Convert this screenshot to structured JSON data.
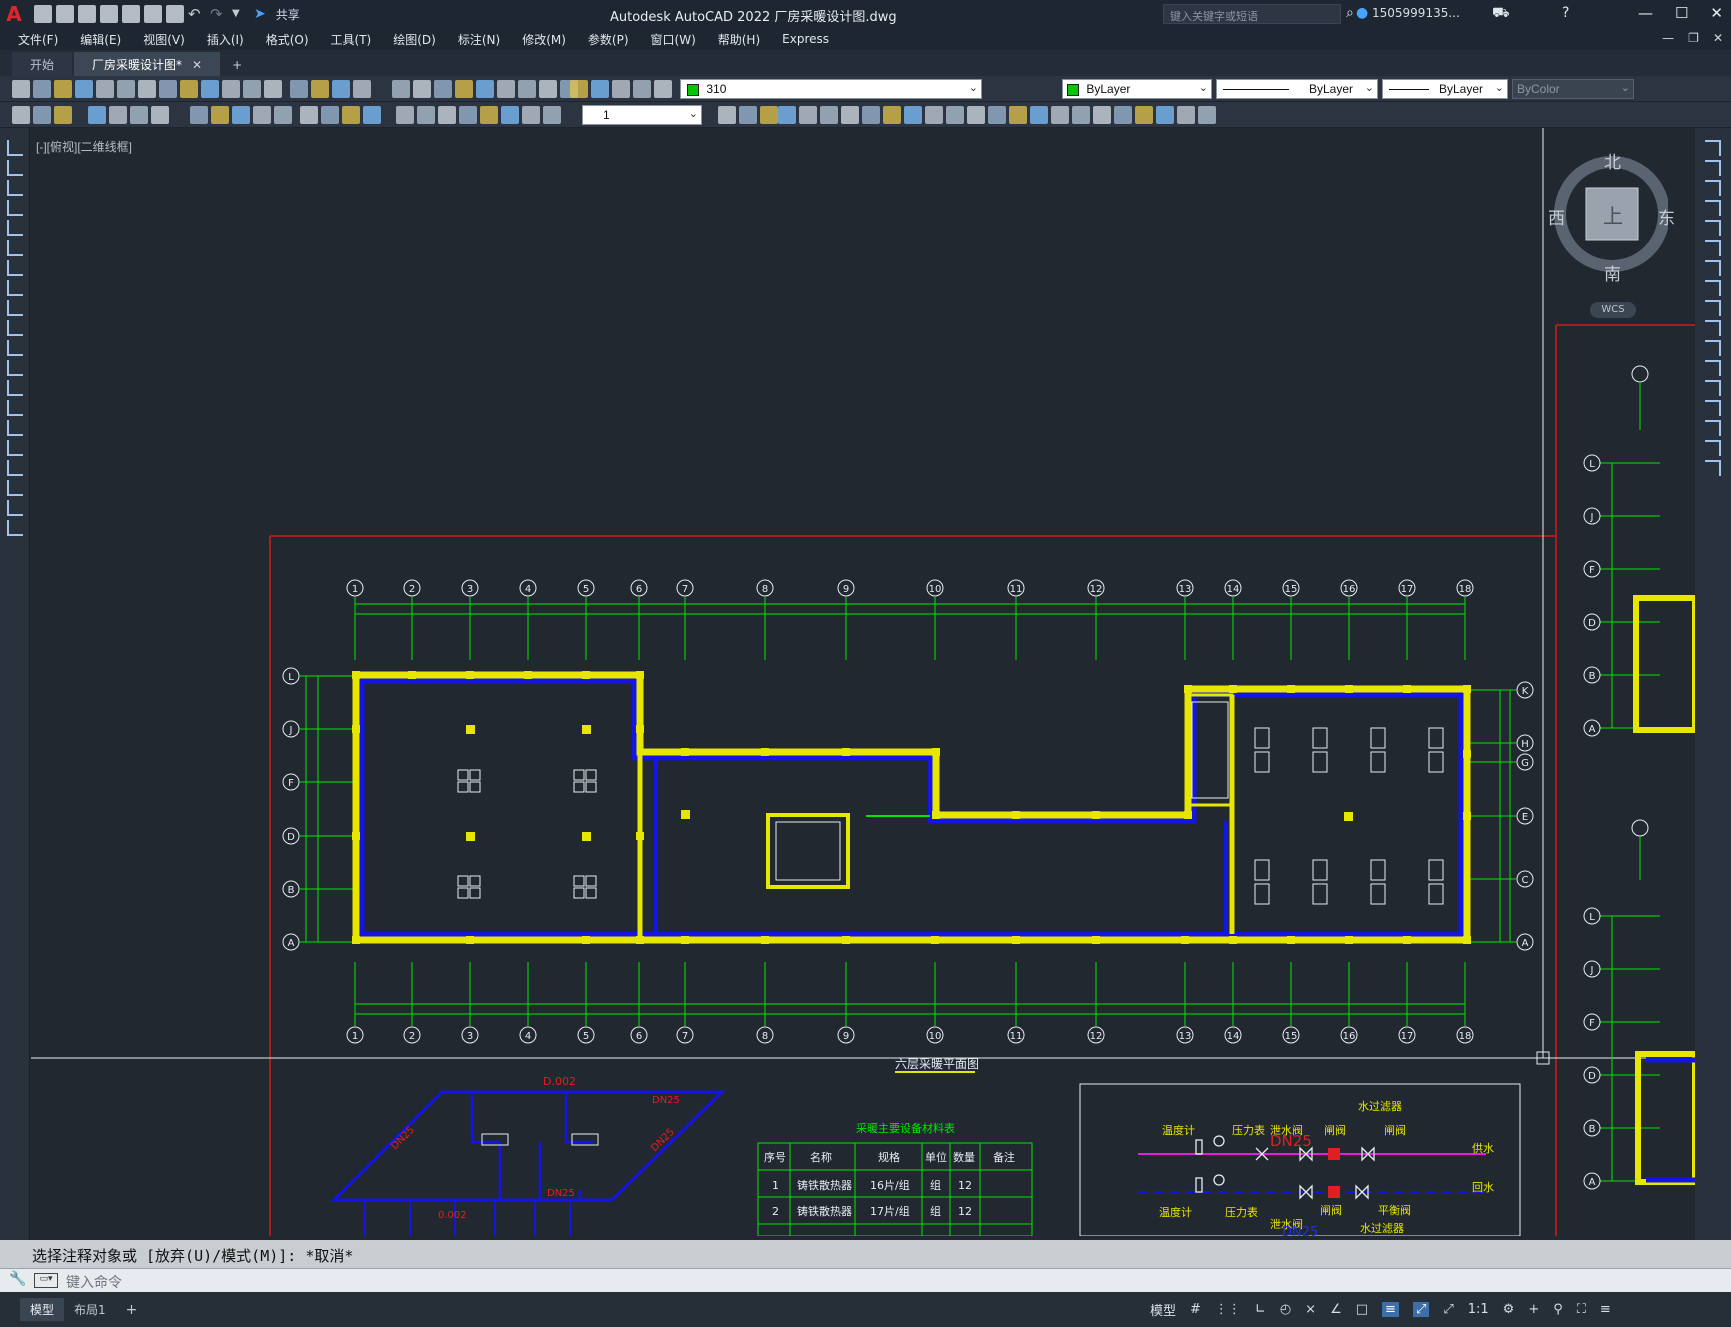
{
  "app": {
    "logo": "A",
    "title": "Autodesk AutoCAD 2022    厂房采暖设计图.dwg",
    "share": "共享",
    "search_placeholder": "键入关键字或短语",
    "user": "1505999135...",
    "window_controls": [
      "—",
      "☐",
      "✕"
    ]
  },
  "menu": [
    "文件(F)",
    "编辑(E)",
    "视图(V)",
    "插入(I)",
    "格式(O)",
    "工具(T)",
    "绘图(D)",
    "标注(N)",
    "修改(M)",
    "参数(P)",
    "窗口(W)",
    "帮助(H)",
    "Express"
  ],
  "tabs": {
    "start": "开始",
    "active": "厂房采暖设计图*",
    "close": "✕",
    "add": "+"
  },
  "toolbar": {
    "layer_value": "310",
    "color_value": "ByLayer",
    "linetype_value": "ByLayer",
    "lineweight_value": "ByLayer",
    "plotstyle_value": "ByColor",
    "scale_value": "1",
    "layer_color": "#00c800"
  },
  "viewport": {
    "label": "[-][俯视][二维线框]"
  },
  "viewcube": {
    "north": "北",
    "south": "南",
    "east": "东",
    "west": "西",
    "top": "上",
    "wcs": "WCS"
  },
  "drawing": {
    "axis_top": [
      "1",
      "2",
      "3",
      "4",
      "5",
      "6",
      "7",
      "8",
      "9",
      "10",
      "11",
      "12",
      "13",
      "14",
      "15",
      "16",
      "17",
      "18"
    ],
    "axis_left": [
      "L",
      "J",
      "F",
      "D",
      "B",
      "A"
    ],
    "axis_right": [
      "K",
      "H",
      "G",
      "E",
      "C",
      "A"
    ],
    "plan_title": "六层采暖平面图",
    "iso_labels": [
      "D.002",
      "DN25",
      "DN25",
      "DN25",
      "DN25",
      "0.002"
    ],
    "table_title": "采暖主要设备材料表",
    "table_headers": [
      "序号",
      "名称",
      "规格",
      "单位",
      "数量",
      "备注"
    ],
    "table_rows": [
      [
        "1",
        "铸铁散热器",
        "16片/组",
        "组",
        "12",
        ""
      ],
      [
        "2",
        "铸铁散热器",
        "17片/组",
        "组",
        "12",
        ""
      ]
    ],
    "legend_labels": [
      "温度计",
      "压力表",
      "泄水阀",
      "闸阀",
      "水过滤器",
      "闸阀",
      "DN25",
      "供水",
      "回水",
      "温度计",
      "压力表",
      "泄水阀",
      "闸阀",
      "平衡阀",
      "水过滤器",
      "DN25"
    ]
  },
  "command": {
    "history": "选择注释对象或 [放弃(U)/模式(M)]: *取消*",
    "input_placeholder": "键入命令"
  },
  "status": {
    "model_tab": "模型",
    "layout_tab": "布局1",
    "add": "+",
    "model_btn": "模型",
    "scale": "1:1"
  }
}
